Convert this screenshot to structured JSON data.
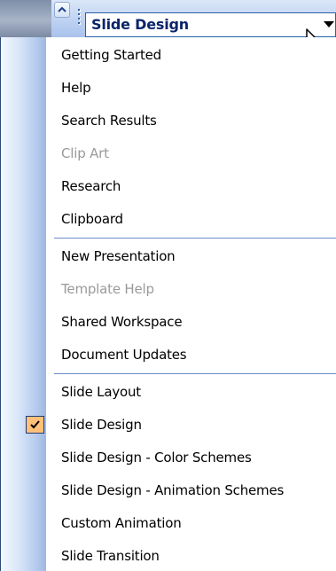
{
  "title": {
    "text": "Slide Design"
  },
  "menu": {
    "items": [
      {
        "label": "Getting Started",
        "enabled": true,
        "checked": false
      },
      {
        "label": "Help",
        "enabled": true,
        "checked": false
      },
      {
        "label": "Search Results",
        "enabled": true,
        "checked": false
      },
      {
        "label": "Clip Art",
        "enabled": false,
        "checked": false
      },
      {
        "label": "Research",
        "enabled": true,
        "checked": false
      },
      {
        "label": "Clipboard",
        "enabled": true,
        "checked": false
      },
      {
        "label": "New Presentation",
        "enabled": true,
        "checked": false
      },
      {
        "label": "Template Help",
        "enabled": false,
        "checked": false
      },
      {
        "label": "Shared Workspace",
        "enabled": true,
        "checked": false
      },
      {
        "label": "Document Updates",
        "enabled": true,
        "checked": false
      },
      {
        "label": "Slide Layout",
        "enabled": true,
        "checked": false
      },
      {
        "label": "Slide Design",
        "enabled": true,
        "checked": true
      },
      {
        "label": "Slide Design - Color Schemes",
        "enabled": true,
        "checked": false
      },
      {
        "label": "Slide Design - Animation Schemes",
        "enabled": true,
        "checked": false
      },
      {
        "label": "Custom Animation",
        "enabled": true,
        "checked": false
      },
      {
        "label": "Slide Transition",
        "enabled": true,
        "checked": false
      }
    ]
  },
  "icons": {
    "scroll_up": "chevron-up-icon",
    "grip": "grip-handle-icon",
    "dropdown": "dropdown-arrow-icon",
    "cursor": "mouse-pointer-icon",
    "check": "checkmark-icon"
  },
  "colors": {
    "title_text": "#0a246a",
    "check_background": "#ffc07a",
    "separator": "#6a8cc7",
    "disabled_text": "#9a9a9a"
  }
}
